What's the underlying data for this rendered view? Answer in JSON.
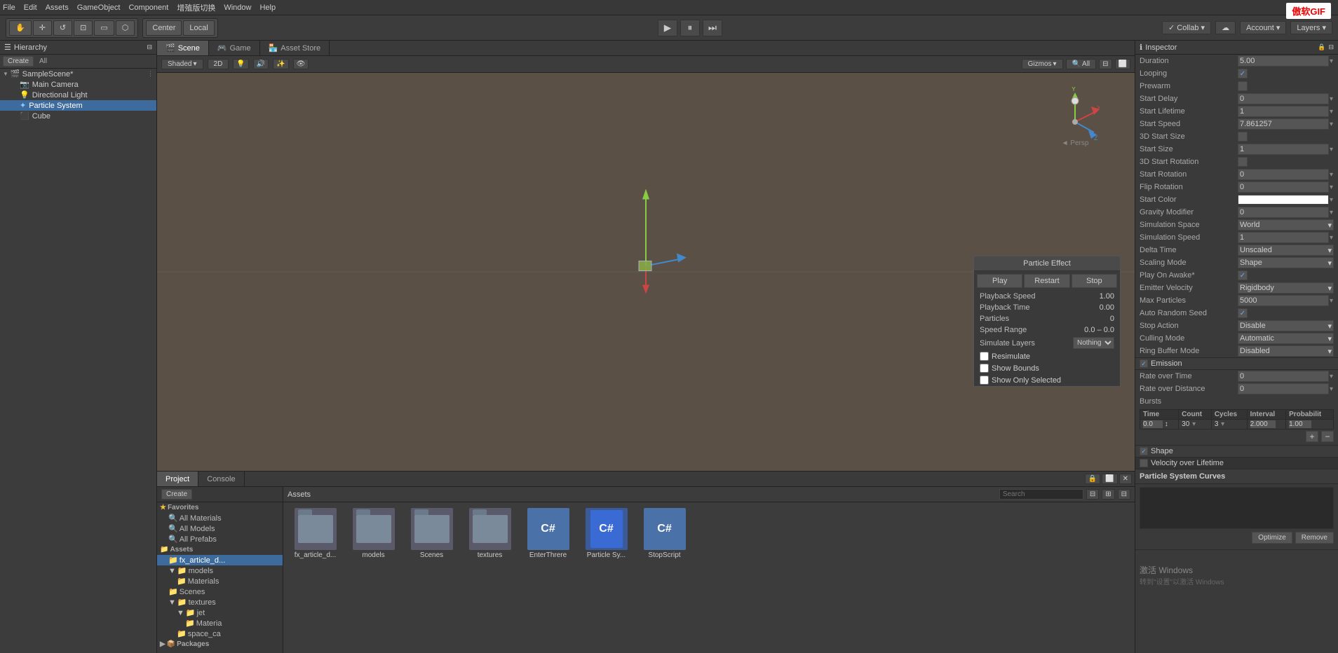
{
  "menubar": {
    "items": [
      "File",
      "Edit",
      "Assets",
      "GameObject",
      "Component",
      "增殖版切换",
      "Window",
      "Help"
    ]
  },
  "toolbar": {
    "transform_tools": [
      "⬛",
      "✛",
      "↔",
      "⟳",
      "⊡",
      "⬡"
    ],
    "pivot_label": "Center",
    "local_label": "Local",
    "play_tooltip": "Play",
    "pause_tooltip": "Pause",
    "step_tooltip": "Step",
    "collab_label": "✓ Collab ▾",
    "cloud_icon": "☁",
    "account_label": "Account ▾",
    "layers_label": "Layers ▾"
  },
  "hierarchy": {
    "title": "Hierarchy",
    "create_label": "Create",
    "all_label": "All",
    "scene_name": "SampleScene*",
    "items": [
      {
        "label": "Main Camera",
        "type": "camera",
        "indent": 1
      },
      {
        "label": "Directional Light",
        "type": "light",
        "indent": 1
      },
      {
        "label": "Particle System",
        "type": "particle",
        "indent": 1,
        "selected": true
      },
      {
        "label": "Cube",
        "type": "cube",
        "indent": 1
      }
    ]
  },
  "view_tabs": [
    {
      "label": "Scene",
      "icon": "🎬",
      "active": true
    },
    {
      "label": "Game",
      "icon": "🎮"
    },
    {
      "label": "Asset Store",
      "icon": "🏪"
    }
  ],
  "scene_toolbar": {
    "shaded_label": "Shaded",
    "mode_label": "2D",
    "gizmos_label": "Gizmos",
    "all_label": "All"
  },
  "particle_popup": {
    "title": "Particle Effect",
    "play_label": "Play",
    "restart_label": "Restart",
    "stop_label": "Stop",
    "playback_speed_label": "Playback Speed",
    "playback_speed_value": "1.00",
    "playback_time_label": "Playback Time",
    "playback_time_value": "0.00",
    "particles_label": "Particles",
    "particles_value": "0",
    "speed_range_label": "Speed Range",
    "speed_range_value": "0.0 – 0.0",
    "simulate_layers_label": "Simulate Layers",
    "simulate_layers_value": "Nothing",
    "resimulate_label": "Resimulate",
    "show_bounds_label": "Show Bounds",
    "show_only_selected_label": "Show Only Selected"
  },
  "inspector": {
    "title": "Inspector",
    "duration_label": "Duration",
    "duration_value": "5.00",
    "looping_label": "Looping",
    "looping_checked": true,
    "prewarm_label": "Prewarm",
    "prewarm_checked": false,
    "start_delay_label": "Start Delay",
    "start_delay_value": "0",
    "start_lifetime_label": "Start Lifetime",
    "start_lifetime_value": "1",
    "start_speed_label": "Start Speed",
    "start_speed_value": "7.861257",
    "3d_start_size_label": "3D Start Size",
    "3d_start_size_checked": false,
    "start_size_label": "Start Size",
    "start_size_value": "1",
    "3d_start_rotation_label": "3D Start Rotation",
    "3d_start_rotation_checked": false,
    "start_rotation_label": "Start Rotation",
    "start_rotation_value": "0",
    "flip_rotation_label": "Flip Rotation",
    "flip_rotation_value": "0",
    "start_color_label": "Start Color",
    "gravity_modifier_label": "Gravity Modifier",
    "gravity_modifier_value": "0",
    "simulation_space_label": "Simulation Space",
    "simulation_space_value": "World",
    "simulation_speed_label": "Simulation Speed",
    "simulation_speed_value": "1",
    "delta_time_label": "Delta Time",
    "delta_time_value": "Unscaled",
    "scaling_mode_label": "Scaling Mode",
    "scaling_mode_value": "Shape",
    "play_on_awake_label": "Play On Awake*",
    "play_on_awake_checked": true,
    "emitter_velocity_label": "Emitter Velocity",
    "emitter_velocity_value": "Rigidbody",
    "max_particles_label": "Max Particles",
    "max_particles_value": "5000",
    "auto_random_seed_label": "Auto Random Seed",
    "auto_random_seed_checked": true,
    "stop_action_label": "Stop Action",
    "stop_action_value": "Disable",
    "culling_mode_label": "Culling Mode",
    "culling_mode_value": "Automatic",
    "ring_buffer_mode_label": "Ring Buffer Mode",
    "ring_buffer_mode_value": "Disabled",
    "emission_section": "Emission",
    "emission_checked": true,
    "rate_over_time_label": "Rate over Time",
    "rate_over_time_value": "0",
    "rate_over_distance_label": "Rate over Distance",
    "rate_over_distance_value": "0",
    "bursts_label": "Bursts",
    "bursts_headers": [
      "Time",
      "Count",
      "Cycles",
      "Interval",
      "Probabilit"
    ],
    "bursts_row": [
      "0.0↕",
      "30 ▾",
      "3 ▾",
      "2.000",
      "1.00"
    ],
    "shape_section": "Shape",
    "shape_checked": true,
    "velocity_section": "Velocity over Lifetime",
    "curves_section": "Particle System Curves",
    "optimize_label": "Optimize",
    "remove_label": "Remove"
  },
  "bottom_tabs": [
    {
      "label": "Project",
      "active": true
    },
    {
      "label": "Console"
    }
  ],
  "project_tree": {
    "favorites": {
      "label": "Favorites",
      "items": [
        "All Materials",
        "All Models",
        "All Prefabs"
      ]
    },
    "assets": {
      "label": "Assets",
      "items": [
        {
          "label": "fx_article_d...",
          "type": "folder",
          "indent": 1
        },
        {
          "label": "models",
          "type": "folder",
          "indent": 1,
          "expanded": true
        },
        {
          "label": "Materials",
          "type": "folder",
          "indent": 2
        },
        {
          "label": "Scenes",
          "type": "folder",
          "indent": 1
        },
        {
          "label": "textures",
          "type": "folder",
          "indent": 1,
          "expanded": true
        },
        {
          "label": "jet",
          "type": "folder",
          "indent": 2,
          "expanded": true
        },
        {
          "label": "Materia",
          "type": "folder",
          "indent": 3
        },
        {
          "label": "space_ca",
          "type": "folder",
          "indent": 2
        }
      ]
    },
    "packages": {
      "label": "Packages"
    }
  },
  "asset_grid": {
    "path_label": "Assets",
    "items": [
      {
        "label": "fx_article_d...",
        "type": "folder"
      },
      {
        "label": "models",
        "type": "folder"
      },
      {
        "label": "Scenes",
        "type": "folder"
      },
      {
        "label": "textures",
        "type": "folder"
      },
      {
        "label": "EnterThrere",
        "type": "cs"
      },
      {
        "label": "Particle Sy...",
        "type": "cs-blue"
      },
      {
        "label": "StopScript",
        "type": "cs"
      }
    ]
  }
}
